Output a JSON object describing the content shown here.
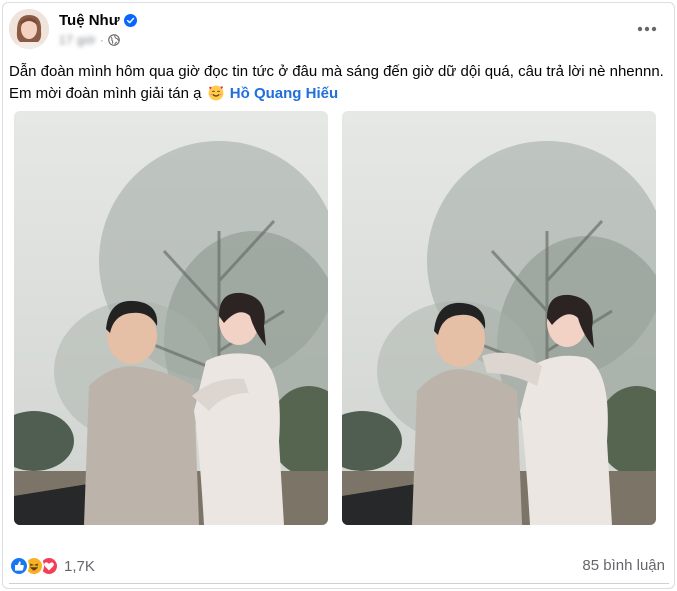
{
  "post": {
    "author_name": "Tuệ Như",
    "verified_icon": "verified-badge-icon",
    "timestamp": "17 giờ",
    "privacy_icon": "globe-icon",
    "more_icon": "more-options-icon",
    "caption_line1": "Dẫn đoàn mình hôm qua giờ đọc tin tức ở đâu mà sáng đến giờ dữ dội quá, câu trả lời nè nhennn.",
    "caption_line2_prefix": "Em mời đoàn mình giải tán ạ",
    "caption_emoji": "smiling-face-with-hearts-emoji",
    "mention": "Hồ Quang Hiếu"
  },
  "photos": [
    {
      "label": "photo-1"
    },
    {
      "label": "photo-2"
    }
  ],
  "footer": {
    "reaction_icons": [
      "like-icon",
      "haha-icon",
      "love-icon"
    ],
    "reaction_count": "1,7K",
    "comments": "85 bình luận"
  },
  "colors": {
    "accent": "#216fdb",
    "verified": "#0866ff",
    "like": "#1877f2",
    "love": "#f33e58",
    "haha": "#f7b125"
  }
}
